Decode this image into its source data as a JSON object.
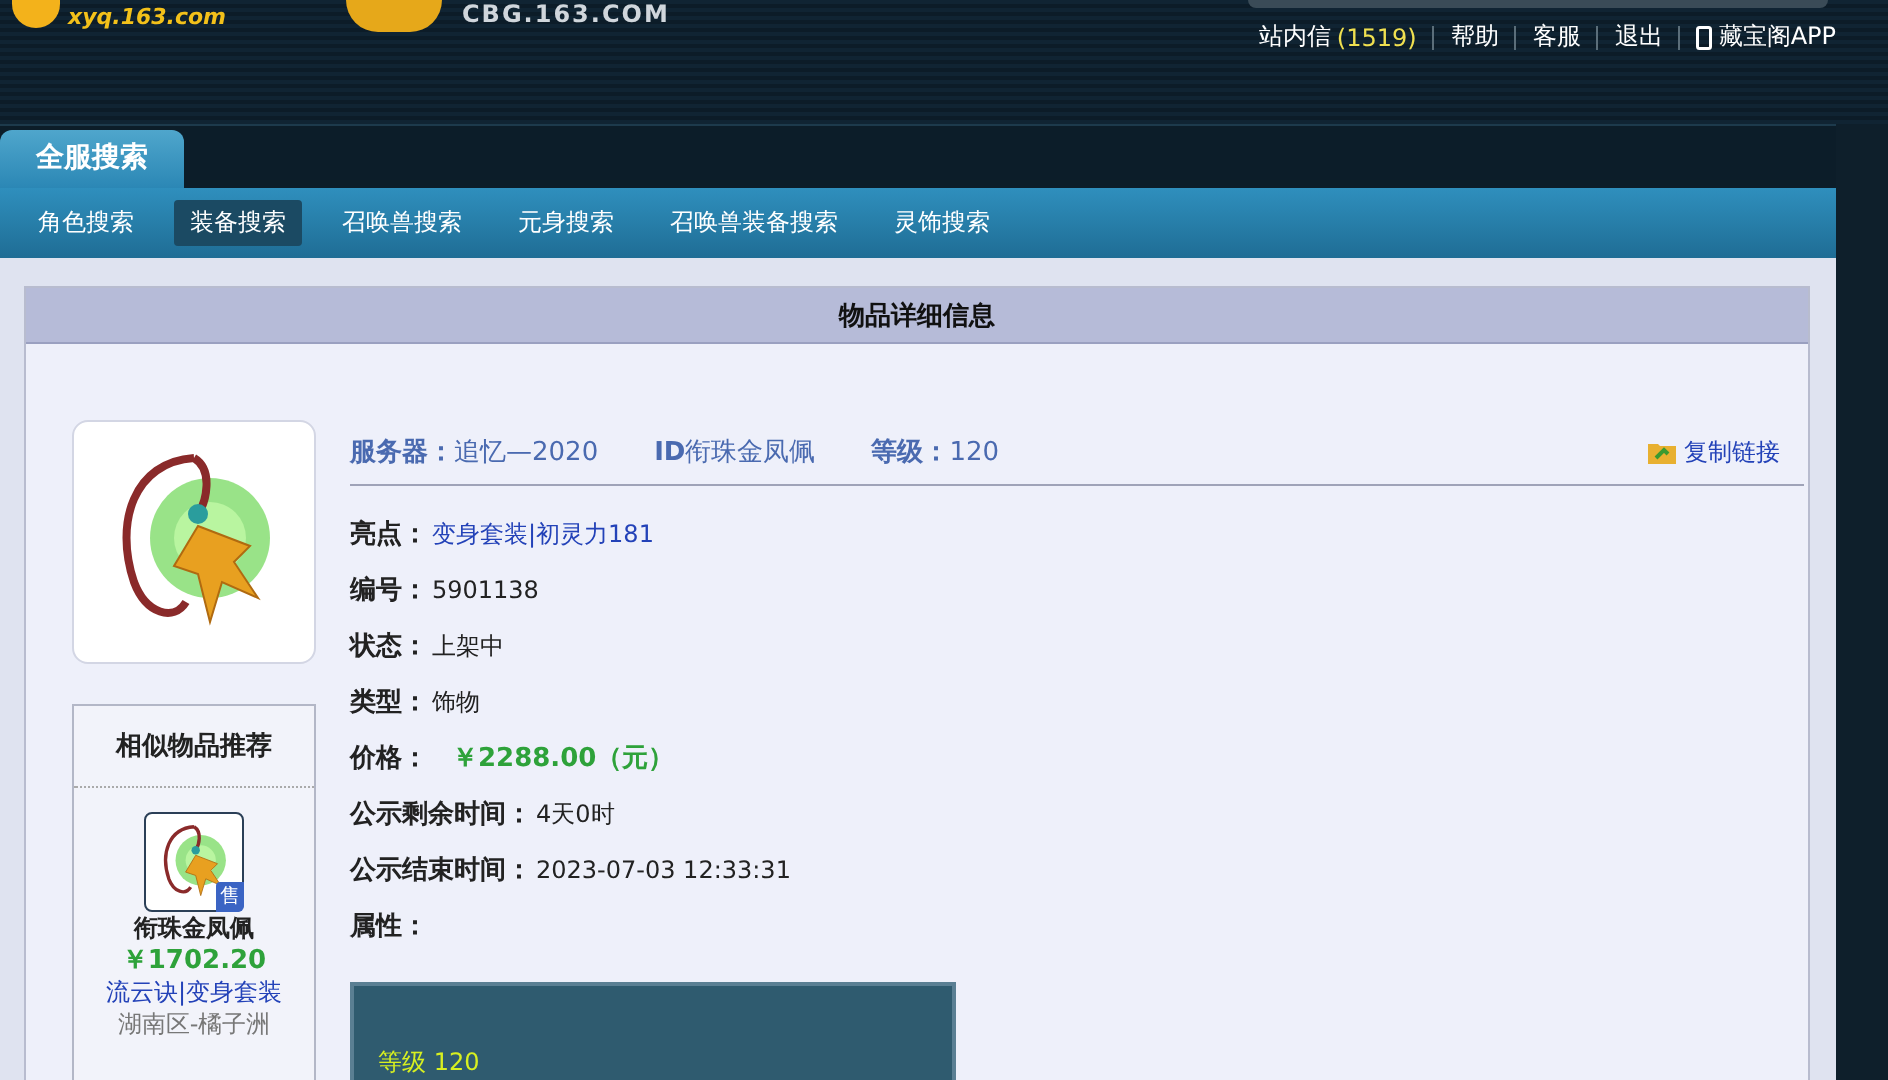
{
  "header": {
    "logos": [
      {
        "text": "xyq.163.com",
        "kind": "site"
      },
      {
        "text": "CBG.163.COM",
        "kind": "cbg"
      }
    ],
    "links": [
      {
        "label": "站内信",
        "count": "(1519)"
      },
      {
        "label": "帮助"
      },
      {
        "label": "客服"
      },
      {
        "label": "退出"
      },
      {
        "label": "藏宝阁APP",
        "kind": "phone"
      }
    ]
  },
  "main_tab": {
    "label": "全服搜索"
  },
  "nav": [
    {
      "label": "角色搜索",
      "selected": false
    },
    {
      "label": "装备搜索",
      "selected": true
    },
    {
      "label": "召唤兽搜索",
      "selected": false
    },
    {
      "label": "元身搜索",
      "selected": false
    },
    {
      "label": "召唤兽装备搜索",
      "selected": false
    },
    {
      "label": "灵饰搜索",
      "selected": false
    }
  ],
  "detail": {
    "title": "物品详细信息",
    "summary": [
      {
        "label": "服务器：",
        "value": "追忆—2020"
      },
      {
        "label": "ID",
        "value": "衔珠金凤佩"
      },
      {
        "label": "等级：",
        "value": "120"
      }
    ],
    "copy_link": "复制链接",
    "fields": [
      {
        "label": "亮点：",
        "value": "变身套装|初灵力181",
        "kind": "link"
      },
      {
        "label": "编号：",
        "value": "5901138",
        "kind": "plain"
      },
      {
        "label": "状态：",
        "value": "上架中",
        "kind": "plain"
      },
      {
        "label": "类型：",
        "value": "饰物",
        "kind": "plain"
      },
      {
        "label": "价格：",
        "value": "￥2288.00（元）",
        "kind": "price"
      },
      {
        "label": "公示剩余时间：",
        "value": "4天0时",
        "kind": "plain"
      },
      {
        "label": "公示结束时间：",
        "value": "2023-07-03 12:33:31",
        "kind": "plain"
      },
      {
        "label": "属性："
      }
    ],
    "attributes": [
      "等级 120"
    ]
  },
  "similar": {
    "title": "相似物品推荐",
    "items": [
      {
        "name": "衔珠金凤佩",
        "badge": "售",
        "price": "￥1702.20",
        "tags": "流云诀|变身套装",
        "server": "湖南区-橘子洲"
      }
    ]
  }
}
